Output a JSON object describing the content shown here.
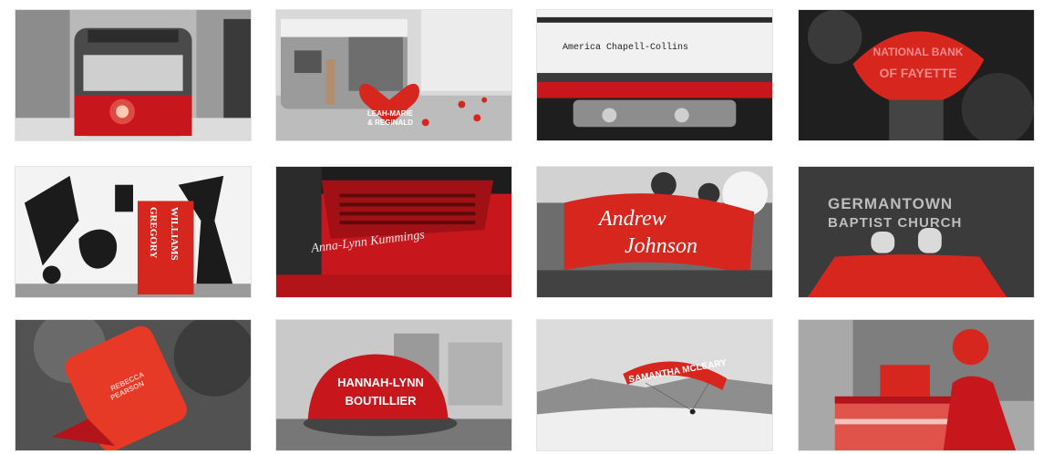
{
  "gallery": {
    "tiles": [
      {
        "id": "streetcar",
        "lines": []
      },
      {
        "id": "camper-heart",
        "lines": [
          "LEAH-MARIE",
          "& REGINALD"
        ]
      },
      {
        "id": "typewriter",
        "lines": [
          "America Chapell-Collins"
        ]
      },
      {
        "id": "umbrella",
        "lines": [
          "NATIONAL BANK",
          "OF FAYETTE"
        ]
      },
      {
        "id": "mural-sign",
        "lines": [
          "GREGORY",
          "WILLIAMS"
        ]
      },
      {
        "id": "red-car",
        "lines": [
          "Anna-Lynn Kummings"
        ]
      },
      {
        "id": "banner-crowd",
        "lines": [
          "Andrew",
          "Johnson"
        ]
      },
      {
        "id": "sidewalk",
        "lines": [
          "GERMANTOWN",
          "BAPTIST CHURCH"
        ]
      },
      {
        "id": "phone",
        "lines": [
          "REBECCA",
          "PEARSON"
        ]
      },
      {
        "id": "cap",
        "lines": [
          "HANNAH-LYNN",
          "BOUTILLIER"
        ]
      },
      {
        "id": "paraglider",
        "lines": [
          "SAMANTHA MCLEARY"
        ]
      },
      {
        "id": "gifts",
        "lines": []
      }
    ]
  },
  "colors": {
    "accent": "#d7261e",
    "accent_dark": "#9e1410",
    "gray_light": "#d9d9d9",
    "gray_dark": "#2e2e2e"
  }
}
